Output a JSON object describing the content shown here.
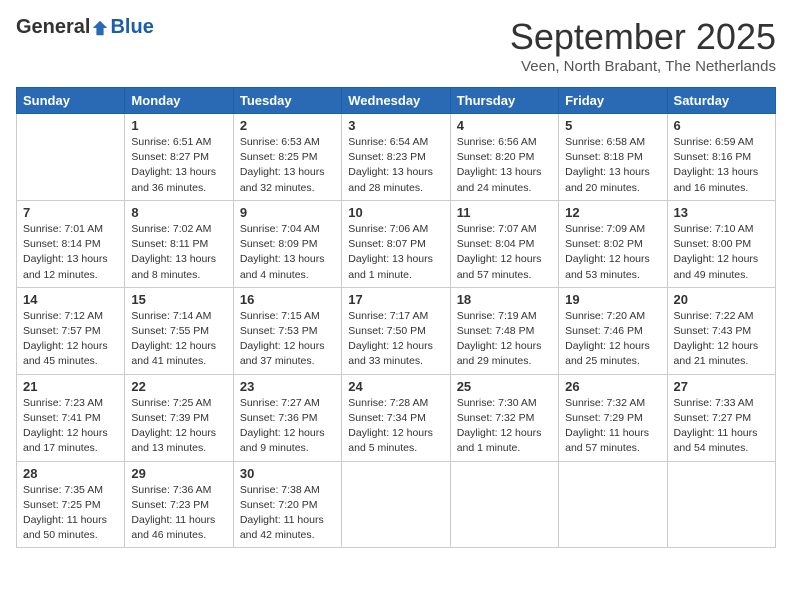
{
  "header": {
    "logo_general": "General",
    "logo_blue": "Blue",
    "month_title": "September 2025",
    "subtitle": "Veen, North Brabant, The Netherlands"
  },
  "days_of_week": [
    "Sunday",
    "Monday",
    "Tuesday",
    "Wednesday",
    "Thursday",
    "Friday",
    "Saturday"
  ],
  "weeks": [
    [
      {
        "day": "",
        "info": ""
      },
      {
        "day": "1",
        "info": "Sunrise: 6:51 AM\nSunset: 8:27 PM\nDaylight: 13 hours\nand 36 minutes."
      },
      {
        "day": "2",
        "info": "Sunrise: 6:53 AM\nSunset: 8:25 PM\nDaylight: 13 hours\nand 32 minutes."
      },
      {
        "day": "3",
        "info": "Sunrise: 6:54 AM\nSunset: 8:23 PM\nDaylight: 13 hours\nand 28 minutes."
      },
      {
        "day": "4",
        "info": "Sunrise: 6:56 AM\nSunset: 8:20 PM\nDaylight: 13 hours\nand 24 minutes."
      },
      {
        "day": "5",
        "info": "Sunrise: 6:58 AM\nSunset: 8:18 PM\nDaylight: 13 hours\nand 20 minutes."
      },
      {
        "day": "6",
        "info": "Sunrise: 6:59 AM\nSunset: 8:16 PM\nDaylight: 13 hours\nand 16 minutes."
      }
    ],
    [
      {
        "day": "7",
        "info": "Sunrise: 7:01 AM\nSunset: 8:14 PM\nDaylight: 13 hours\nand 12 minutes."
      },
      {
        "day": "8",
        "info": "Sunrise: 7:02 AM\nSunset: 8:11 PM\nDaylight: 13 hours\nand 8 minutes."
      },
      {
        "day": "9",
        "info": "Sunrise: 7:04 AM\nSunset: 8:09 PM\nDaylight: 13 hours\nand 4 minutes."
      },
      {
        "day": "10",
        "info": "Sunrise: 7:06 AM\nSunset: 8:07 PM\nDaylight: 13 hours\nand 1 minute."
      },
      {
        "day": "11",
        "info": "Sunrise: 7:07 AM\nSunset: 8:04 PM\nDaylight: 12 hours\nand 57 minutes."
      },
      {
        "day": "12",
        "info": "Sunrise: 7:09 AM\nSunset: 8:02 PM\nDaylight: 12 hours\nand 53 minutes."
      },
      {
        "day": "13",
        "info": "Sunrise: 7:10 AM\nSunset: 8:00 PM\nDaylight: 12 hours\nand 49 minutes."
      }
    ],
    [
      {
        "day": "14",
        "info": "Sunrise: 7:12 AM\nSunset: 7:57 PM\nDaylight: 12 hours\nand 45 minutes."
      },
      {
        "day": "15",
        "info": "Sunrise: 7:14 AM\nSunset: 7:55 PM\nDaylight: 12 hours\nand 41 minutes."
      },
      {
        "day": "16",
        "info": "Sunrise: 7:15 AM\nSunset: 7:53 PM\nDaylight: 12 hours\nand 37 minutes."
      },
      {
        "day": "17",
        "info": "Sunrise: 7:17 AM\nSunset: 7:50 PM\nDaylight: 12 hours\nand 33 minutes."
      },
      {
        "day": "18",
        "info": "Sunrise: 7:19 AM\nSunset: 7:48 PM\nDaylight: 12 hours\nand 29 minutes."
      },
      {
        "day": "19",
        "info": "Sunrise: 7:20 AM\nSunset: 7:46 PM\nDaylight: 12 hours\nand 25 minutes."
      },
      {
        "day": "20",
        "info": "Sunrise: 7:22 AM\nSunset: 7:43 PM\nDaylight: 12 hours\nand 21 minutes."
      }
    ],
    [
      {
        "day": "21",
        "info": "Sunrise: 7:23 AM\nSunset: 7:41 PM\nDaylight: 12 hours\nand 17 minutes."
      },
      {
        "day": "22",
        "info": "Sunrise: 7:25 AM\nSunset: 7:39 PM\nDaylight: 12 hours\nand 13 minutes."
      },
      {
        "day": "23",
        "info": "Sunrise: 7:27 AM\nSunset: 7:36 PM\nDaylight: 12 hours\nand 9 minutes."
      },
      {
        "day": "24",
        "info": "Sunrise: 7:28 AM\nSunset: 7:34 PM\nDaylight: 12 hours\nand 5 minutes."
      },
      {
        "day": "25",
        "info": "Sunrise: 7:30 AM\nSunset: 7:32 PM\nDaylight: 12 hours\nand 1 minute."
      },
      {
        "day": "26",
        "info": "Sunrise: 7:32 AM\nSunset: 7:29 PM\nDaylight: 11 hours\nand 57 minutes."
      },
      {
        "day": "27",
        "info": "Sunrise: 7:33 AM\nSunset: 7:27 PM\nDaylight: 11 hours\nand 54 minutes."
      }
    ],
    [
      {
        "day": "28",
        "info": "Sunrise: 7:35 AM\nSunset: 7:25 PM\nDaylight: 11 hours\nand 50 minutes."
      },
      {
        "day": "29",
        "info": "Sunrise: 7:36 AM\nSunset: 7:23 PM\nDaylight: 11 hours\nand 46 minutes."
      },
      {
        "day": "30",
        "info": "Sunrise: 7:38 AM\nSunset: 7:20 PM\nDaylight: 11 hours\nand 42 minutes."
      },
      {
        "day": "",
        "info": ""
      },
      {
        "day": "",
        "info": ""
      },
      {
        "day": "",
        "info": ""
      },
      {
        "day": "",
        "info": ""
      }
    ]
  ]
}
